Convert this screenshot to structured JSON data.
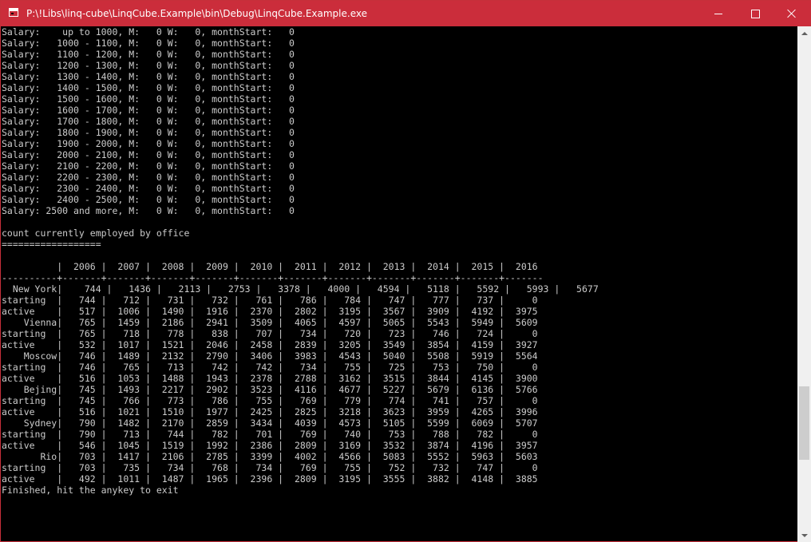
{
  "window": {
    "title": "P:\\!Libs\\linq-cube\\LinqCube.Example\\bin\\Debug\\LinqCube.Example.exe",
    "colors": {
      "titlebar": "#cb2d3b",
      "console_bg": "#000000",
      "console_fg": "#cccccc"
    },
    "controls": {
      "minimize": "minimize-icon",
      "maximize": "maximize-icon",
      "close": "close-icon"
    }
  },
  "console": {
    "lines": [
      "Salary:    up to 1000, M:   0 W:   0, monthStart:   0",
      "Salary:   1000 - 1100, M:   0 W:   0, monthStart:   0",
      "Salary:   1100 - 1200, M:   0 W:   0, monthStart:   0",
      "Salary:   1200 - 1300, M:   0 W:   0, monthStart:   0",
      "Salary:   1300 - 1400, M:   0 W:   0, monthStart:   0",
      "Salary:   1400 - 1500, M:   0 W:   0, monthStart:   0",
      "Salary:   1500 - 1600, M:   0 W:   0, monthStart:   0",
      "Salary:   1600 - 1700, M:   0 W:   0, monthStart:   0",
      "Salary:   1700 - 1800, M:   0 W:   0, monthStart:   0",
      "Salary:   1800 - 1900, M:   0 W:   0, monthStart:   0",
      "Salary:   1900 - 2000, M:   0 W:   0, monthStart:   0",
      "Salary:   2000 - 2100, M:   0 W:   0, monthStart:   0",
      "Salary:   2100 - 2200, M:   0 W:   0, monthStart:   0",
      "Salary:   2200 - 2300, M:   0 W:   0, monthStart:   0",
      "Salary:   2300 - 2400, M:   0 W:   0, monthStart:   0",
      "Salary:   2400 - 2500, M:   0 W:   0, monthStart:   0",
      "Salary: 2500 and more, M:   0 W:   0, monthStart:   0",
      "",
      "count currently employed by office",
      "==================",
      "",
      "          |  2006 |  2007 |  2008 |  2009 |  2010 |  2011 |  2012 |  2013 |  2014 |  2015 |  2016",
      "----------+-------+-------+-------+-------+-------+-------+-------+-------+-------+-------+-------",
      "  New York|    744 |   1436 |   2113 |   2753 |   3378 |   4000 |   4594 |   5118 |   5592 |   5993 |   5677",
      "starting  |   744 |   712 |   731 |   732 |   761 |   786 |   784 |   747 |   777 |   737 |     0",
      "active    |   517 |  1006 |  1490 |  1916 |  2370 |  2802 |  3195 |  3567 |  3909 |  4192 |  3975",
      "    Vienna|   765 |  1459 |  2186 |  2941 |  3509 |  4065 |  4597 |  5065 |  5543 |  5949 |  5609",
      "starting  |   765 |   718 |   778 |   838 |   707 |   734 |   720 |   723 |   746 |   724 |     0",
      "active    |   532 |  1017 |  1521 |  2046 |  2458 |  2839 |  3205 |  3549 |  3854 |  4159 |  3927",
      "    Moscow|   746 |  1489 |  2132 |  2790 |  3406 |  3983 |  4543 |  5040 |  5508 |  5919 |  5564",
      "starting  |   746 |   765 |   713 |   742 |   742 |   734 |   755 |   725 |   753 |   750 |     0",
      "active    |   516 |  1053 |  1488 |  1943 |  2378 |  2788 |  3162 |  3515 |  3844 |  4145 |  3900",
      "    Bejing|   745 |  1493 |  2217 |  2902 |  3523 |  4116 |  4677 |  5227 |  5679 |  6136 |  5766",
      "starting  |   745 |   766 |   773 |   786 |   755 |   769 |   779 |   774 |   741 |   757 |     0",
      "active    |   516 |  1021 |  1510 |  1977 |  2425 |  2825 |  3218 |  3623 |  3959 |  4265 |  3996",
      "    Sydney|   790 |  1482 |  2170 |  2859 |  3434 |  4039 |  4573 |  5105 |  5599 |  6069 |  5707",
      "starting  |   790 |   713 |   744 |   782 |   701 |   769 |   740 |   753 |   788 |   782 |     0",
      "active    |   546 |  1045 |  1519 |  1992 |  2386 |  2809 |  3169 |  3532 |  3874 |  4196 |  3957",
      "       Rio|   703 |  1417 |  2106 |  2785 |  3399 |  4002 |  4566 |  5083 |  5552 |  5963 |  5603",
      "starting  |   703 |   735 |   734 |   768 |   734 |   769 |   755 |   752 |   732 |   747 |     0",
      "active    |   492 |  1011 |  1487 |  1965 |  2396 |  2809 |  3195 |  3555 |  3882 |  4148 |  3885",
      "Finished, hit the anykey to exit"
    ]
  },
  "scrollbar": {
    "up_arrow": "scroll-up-arrow-icon",
    "down_arrow": "scroll-down-arrow-icon"
  }
}
